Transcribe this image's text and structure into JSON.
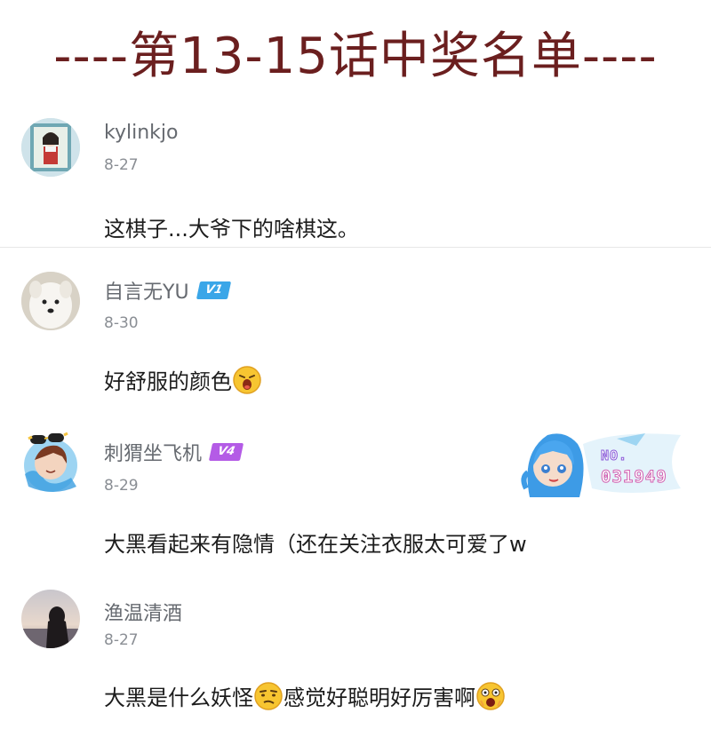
{
  "title": "----第13-15话中奖名单----",
  "colors": {
    "title": "#6b1f1f",
    "badge_v1": "#3aa6e8",
    "badge_v4": "#b45be6"
  },
  "comments": [
    {
      "username": "kylinkjo",
      "date": "8-27",
      "text": "这棋子...大爷下的啥棋这。",
      "avatar_icon": "anime-girl-avatar"
    },
    {
      "username": "自言无YU",
      "badge": "V1",
      "date": "8-30",
      "text": "好舒服的颜色",
      "emoji": "excited-face-emoji",
      "avatar_icon": "white-dog-avatar"
    },
    {
      "username": "刺猬坐飞机",
      "badge": "V4",
      "date": "8-29",
      "text": "大黑看起来有隐情（还在关注衣服太可爱了w",
      "avatar_icon": "anime-boy-sunglasses-avatar",
      "decoration": {
        "no_label": "NO.",
        "number": "031949"
      }
    },
    {
      "username": "渔温清酒",
      "date": "8-27",
      "text_part1": "大黑是什么妖怪",
      "emoji1": "thinking-face-emoji",
      "text_part2": "感觉好聪明好厉害啊",
      "emoji2": "shocked-face-emoji",
      "avatar_icon": "sunset-silhouette-avatar"
    }
  ]
}
